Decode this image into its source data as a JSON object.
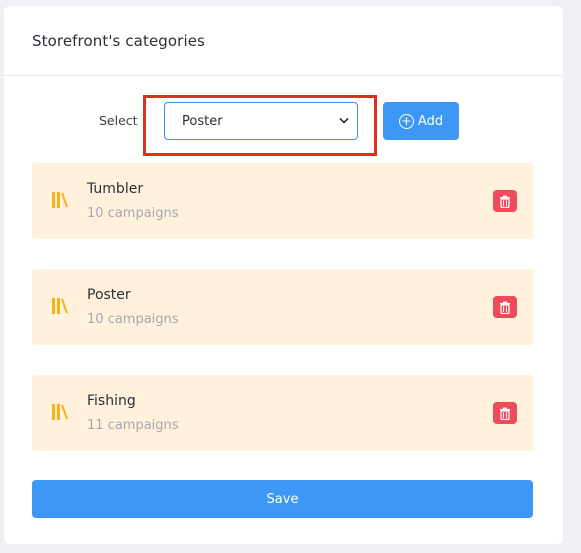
{
  "header": {
    "title": "Storefront's categories"
  },
  "select": {
    "label": "Select",
    "value": "Poster"
  },
  "add_button": {
    "label": "Add"
  },
  "categories": [
    {
      "name": "Tumbler",
      "count": "10 campaigns"
    },
    {
      "name": "Poster",
      "count": "10 campaigns"
    },
    {
      "name": "Fishing",
      "count": "11 campaigns"
    }
  ],
  "save_button": {
    "label": "Save"
  },
  "colors": {
    "accent": "#3d97f4",
    "item_bg": "#fff1dc",
    "delete": "#ee4b5b",
    "highlight": "#e0301e",
    "category_icon": "#f5b21b"
  },
  "icons": {
    "category": "books-icon",
    "delete": "trash-icon",
    "add": "plus-circle-icon",
    "select": "chevron-down-icon"
  }
}
